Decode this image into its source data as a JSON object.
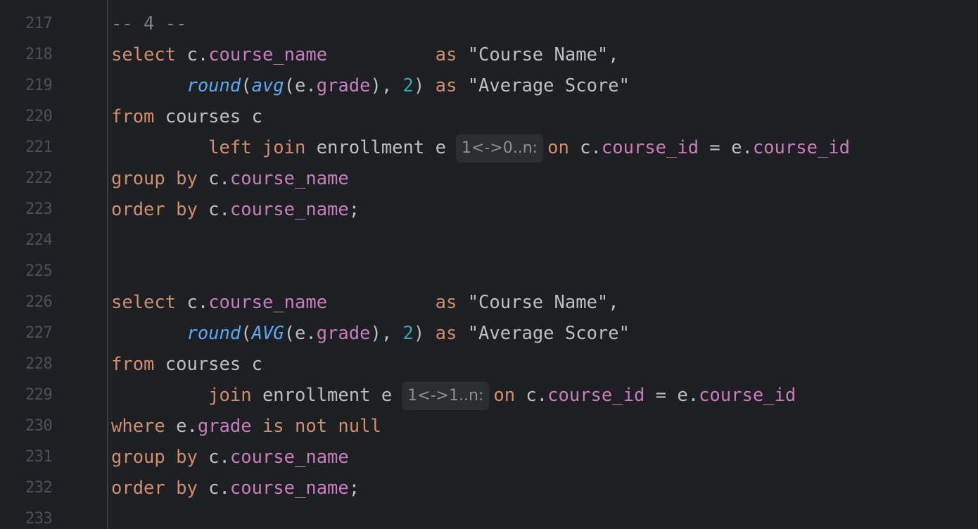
{
  "editor": {
    "language": "sql",
    "lines": [
      {
        "num": "217",
        "tokens": [
          [
            "cm",
            "-- 4 --"
          ]
        ]
      },
      {
        "num": "218",
        "tokens": [
          [
            "kw",
            "select"
          ],
          [
            "plain",
            " c."
          ],
          [
            "col",
            "course_name"
          ],
          [
            "plain",
            "          "
          ],
          [
            "kw",
            "as"
          ],
          [
            "plain",
            " "
          ],
          [
            "str",
            "\"Course Name\""
          ],
          [
            "plain",
            ","
          ]
        ]
      },
      {
        "num": "219",
        "tokens": [
          [
            "plain",
            "       "
          ],
          [
            "fn",
            "round"
          ],
          [
            "plain",
            "("
          ],
          [
            "fn",
            "avg"
          ],
          [
            "plain",
            "(e."
          ],
          [
            "col",
            "grade"
          ],
          [
            "plain",
            "), "
          ],
          [
            "num",
            "2"
          ],
          [
            "plain",
            ") "
          ],
          [
            "kw",
            "as"
          ],
          [
            "plain",
            " "
          ],
          [
            "str",
            "\"Average Score\""
          ]
        ]
      },
      {
        "num": "220",
        "tokens": [
          [
            "kw",
            "from"
          ],
          [
            "plain",
            " courses c"
          ]
        ]
      },
      {
        "num": "221",
        "tokens": [
          [
            "plain",
            "         "
          ],
          [
            "kw",
            "left join"
          ],
          [
            "plain",
            " enrollment e"
          ],
          [
            "hint",
            "1<->0..n:"
          ],
          [
            "kw",
            "on"
          ],
          [
            "plain",
            " c."
          ],
          [
            "col",
            "course_id"
          ],
          [
            "plain",
            " = e."
          ],
          [
            "col",
            "course_id"
          ]
        ]
      },
      {
        "num": "222",
        "tokens": [
          [
            "kw",
            "group by"
          ],
          [
            "plain",
            " c."
          ],
          [
            "col",
            "course_name"
          ]
        ]
      },
      {
        "num": "223",
        "tokens": [
          [
            "kw",
            "order by"
          ],
          [
            "plain",
            " c."
          ],
          [
            "col",
            "course_name"
          ],
          [
            "plain",
            ";"
          ]
        ]
      },
      {
        "num": "224",
        "tokens": []
      },
      {
        "num": "225",
        "tokens": []
      },
      {
        "num": "226",
        "tokens": [
          [
            "kw",
            "select"
          ],
          [
            "plain",
            " c."
          ],
          [
            "col",
            "course_name"
          ],
          [
            "plain",
            "          "
          ],
          [
            "kw",
            "as"
          ],
          [
            "plain",
            " "
          ],
          [
            "str",
            "\"Course Name\""
          ],
          [
            "plain",
            ","
          ]
        ]
      },
      {
        "num": "227",
        "tokens": [
          [
            "plain",
            "       "
          ],
          [
            "fn",
            "round"
          ],
          [
            "plain",
            "("
          ],
          [
            "fn",
            "AVG"
          ],
          [
            "plain",
            "(e."
          ],
          [
            "col",
            "grade"
          ],
          [
            "plain",
            "), "
          ],
          [
            "num",
            "2"
          ],
          [
            "plain",
            ") "
          ],
          [
            "kw",
            "as"
          ],
          [
            "plain",
            " "
          ],
          [
            "str",
            "\"Average Score\""
          ]
        ]
      },
      {
        "num": "228",
        "tokens": [
          [
            "kw",
            "from"
          ],
          [
            "plain",
            " courses c"
          ]
        ]
      },
      {
        "num": "229",
        "tokens": [
          [
            "plain",
            "         "
          ],
          [
            "kw",
            "join"
          ],
          [
            "plain",
            " enrollment e"
          ],
          [
            "hint",
            "1<->1..n:"
          ],
          [
            "kw",
            "on"
          ],
          [
            "plain",
            " c."
          ],
          [
            "col",
            "course_id"
          ],
          [
            "plain",
            " = e."
          ],
          [
            "col",
            "course_id"
          ]
        ]
      },
      {
        "num": "230",
        "tokens": [
          [
            "kw",
            "where"
          ],
          [
            "plain",
            " e."
          ],
          [
            "col",
            "grade"
          ],
          [
            "plain",
            " "
          ],
          [
            "kw",
            "is not null"
          ]
        ]
      },
      {
        "num": "231",
        "tokens": [
          [
            "kw",
            "group by"
          ],
          [
            "plain",
            " c."
          ],
          [
            "col",
            "course_name"
          ]
        ]
      },
      {
        "num": "232",
        "tokens": [
          [
            "kw",
            "order by"
          ],
          [
            "plain",
            " c."
          ],
          [
            "col",
            "course_name"
          ],
          [
            "plain",
            ";"
          ]
        ]
      },
      {
        "num": "233",
        "tokens": []
      }
    ]
  },
  "colors": {
    "background": "#1e1f22",
    "keyword": "#cf8e6d",
    "function": "#56a8f5",
    "column": "#c77dbb",
    "number": "#2aacb8",
    "string": "#bcbec4",
    "comment": "#7a7e85",
    "line_number": "#4b5059",
    "inlay_hint_bg": "#2b2d30"
  }
}
